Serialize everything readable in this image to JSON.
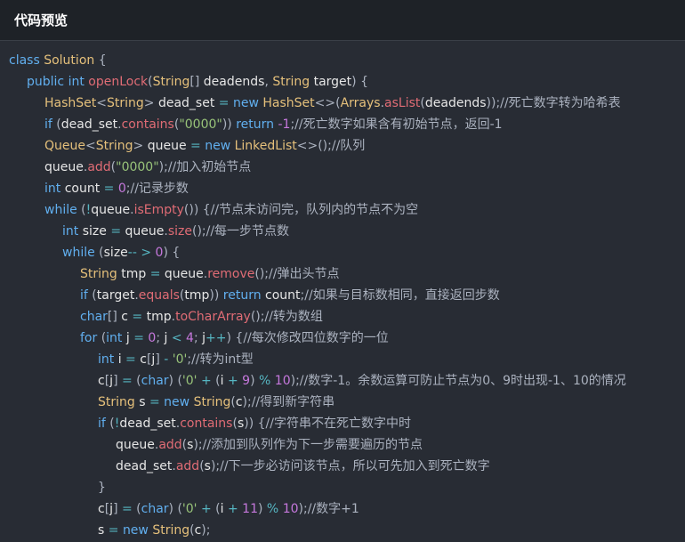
{
  "header": {
    "title": "代码预览"
  },
  "code_lines": [
    {
      "indent": 0,
      "tokens": [
        [
          "kw",
          "class"
        ],
        [
          "sp",
          " "
        ],
        [
          "type",
          "Solution"
        ],
        [
          "pun",
          " {"
        ]
      ]
    },
    {
      "indent": 1,
      "tokens": [
        [
          "kw",
          "public"
        ],
        [
          "sp",
          " "
        ],
        [
          "kw",
          "int"
        ],
        [
          "sp",
          " "
        ],
        [
          "fn",
          "openLock"
        ],
        [
          "pun",
          "("
        ],
        [
          "type",
          "String"
        ],
        [
          "pun",
          "[] "
        ],
        [
          "var",
          "deadends"
        ],
        [
          "pun",
          ", "
        ],
        [
          "type",
          "String"
        ],
        [
          "sp",
          " "
        ],
        [
          "var",
          "target"
        ],
        [
          "pun",
          ") {"
        ]
      ]
    },
    {
      "indent": 2,
      "tokens": [
        [
          "type",
          "HashSet"
        ],
        [
          "pun",
          "<"
        ],
        [
          "type",
          "String"
        ],
        [
          "pun",
          "> "
        ],
        [
          "var",
          "dead_set"
        ],
        [
          "op",
          " = "
        ],
        [
          "kw",
          "new"
        ],
        [
          "sp",
          " "
        ],
        [
          "type",
          "HashSet"
        ],
        [
          "pun",
          "<>("
        ],
        [
          "type",
          "Arrays"
        ],
        [
          "pun",
          "."
        ],
        [
          "fn",
          "asList"
        ],
        [
          "pun",
          "("
        ],
        [
          "var",
          "deadends"
        ],
        [
          "pun",
          "));"
        ],
        [
          "cm",
          "//死亡数字转为哈希表"
        ]
      ]
    },
    {
      "indent": 2,
      "tokens": [
        [
          "kw",
          "if"
        ],
        [
          "pun",
          " ("
        ],
        [
          "var",
          "dead_set"
        ],
        [
          "pun",
          "."
        ],
        [
          "fn",
          "contains"
        ],
        [
          "pun",
          "("
        ],
        [
          "str",
          "\"0000\""
        ],
        [
          "pun",
          ")) "
        ],
        [
          "kw",
          "return"
        ],
        [
          "sp",
          " "
        ],
        [
          "num",
          "-1"
        ],
        [
          "pun",
          ";"
        ],
        [
          "cm",
          "//死亡数字如果含有初始节点，返回-1"
        ]
      ]
    },
    {
      "indent": 2,
      "tokens": [
        [
          "type",
          "Queue"
        ],
        [
          "pun",
          "<"
        ],
        [
          "type",
          "String"
        ],
        [
          "pun",
          "> "
        ],
        [
          "var",
          "queue"
        ],
        [
          "op",
          " = "
        ],
        [
          "kw",
          "new"
        ],
        [
          "sp",
          " "
        ],
        [
          "type",
          "LinkedList"
        ],
        [
          "pun",
          "<>();"
        ],
        [
          "cm",
          "//队列"
        ]
      ]
    },
    {
      "indent": 2,
      "tokens": [
        [
          "var",
          "queue"
        ],
        [
          "pun",
          "."
        ],
        [
          "fn",
          "add"
        ],
        [
          "pun",
          "("
        ],
        [
          "str",
          "\"0000\""
        ],
        [
          "pun",
          ");"
        ],
        [
          "cm",
          "//加入初始节点"
        ]
      ]
    },
    {
      "indent": 2,
      "tokens": [
        [
          "kw",
          "int"
        ],
        [
          "sp",
          " "
        ],
        [
          "var",
          "count"
        ],
        [
          "op",
          " = "
        ],
        [
          "num",
          "0"
        ],
        [
          "pun",
          ";"
        ],
        [
          "cm",
          "//记录步数"
        ]
      ]
    },
    {
      "indent": 2,
      "tokens": [
        [
          "kw",
          "while"
        ],
        [
          "pun",
          " ("
        ],
        [
          "op",
          "!"
        ],
        [
          "var",
          "queue"
        ],
        [
          "pun",
          "."
        ],
        [
          "fn",
          "isEmpty"
        ],
        [
          "pun",
          "()) {"
        ],
        [
          "cm",
          "//节点未访问完，队列内的节点不为空"
        ]
      ]
    },
    {
      "indent": 3,
      "tokens": [
        [
          "kw",
          "int"
        ],
        [
          "sp",
          " "
        ],
        [
          "var",
          "size"
        ],
        [
          "op",
          " = "
        ],
        [
          "var",
          "queue"
        ],
        [
          "pun",
          "."
        ],
        [
          "fn",
          "size"
        ],
        [
          "pun",
          "();"
        ],
        [
          "cm",
          "//每一步节点数"
        ]
      ]
    },
    {
      "indent": 3,
      "tokens": [
        [
          "kw",
          "while"
        ],
        [
          "pun",
          " ("
        ],
        [
          "var",
          "size"
        ],
        [
          "op",
          "-- > "
        ],
        [
          "num",
          "0"
        ],
        [
          "pun",
          ") {"
        ]
      ]
    },
    {
      "indent": 4,
      "tokens": [
        [
          "type",
          "String"
        ],
        [
          "sp",
          " "
        ],
        [
          "var",
          "tmp"
        ],
        [
          "op",
          " = "
        ],
        [
          "var",
          "queue"
        ],
        [
          "pun",
          "."
        ],
        [
          "fn",
          "remove"
        ],
        [
          "pun",
          "();"
        ],
        [
          "cm",
          "//弹出头节点"
        ]
      ]
    },
    {
      "indent": 4,
      "tokens": [
        [
          "kw",
          "if"
        ],
        [
          "pun",
          " ("
        ],
        [
          "var",
          "target"
        ],
        [
          "pun",
          "."
        ],
        [
          "fn",
          "equals"
        ],
        [
          "pun",
          "("
        ],
        [
          "var",
          "tmp"
        ],
        [
          "pun",
          ")) "
        ],
        [
          "kw",
          "return"
        ],
        [
          "sp",
          " "
        ],
        [
          "var",
          "count"
        ],
        [
          "pun",
          ";"
        ],
        [
          "cm",
          "//如果与目标数相同，直接返回步数"
        ]
      ]
    },
    {
      "indent": 4,
      "tokens": [
        [
          "kw",
          "char"
        ],
        [
          "pun",
          "[] "
        ],
        [
          "var",
          "c"
        ],
        [
          "op",
          " = "
        ],
        [
          "var",
          "tmp"
        ],
        [
          "pun",
          "."
        ],
        [
          "fn",
          "toCharArray"
        ],
        [
          "pun",
          "();"
        ],
        [
          "cm",
          "//转为数组"
        ]
      ]
    },
    {
      "indent": 4,
      "tokens": [
        [
          "kw",
          "for"
        ],
        [
          "pun",
          " ("
        ],
        [
          "kw",
          "int"
        ],
        [
          "sp",
          " "
        ],
        [
          "var",
          "j"
        ],
        [
          "op",
          " = "
        ],
        [
          "num",
          "0"
        ],
        [
          "pun",
          "; "
        ],
        [
          "var",
          "j"
        ],
        [
          "op",
          " < "
        ],
        [
          "num",
          "4"
        ],
        [
          "pun",
          "; "
        ],
        [
          "var",
          "j"
        ],
        [
          "op",
          "++"
        ],
        [
          "pun",
          ") {"
        ],
        [
          "cm",
          "//每次修改四位数字的一位"
        ]
      ]
    },
    {
      "indent": 5,
      "tokens": [
        [
          "kw",
          "int"
        ],
        [
          "sp",
          " "
        ],
        [
          "var",
          "i"
        ],
        [
          "op",
          " = "
        ],
        [
          "var",
          "c"
        ],
        [
          "pun",
          "["
        ],
        [
          "var",
          "j"
        ],
        [
          "pun",
          "] "
        ],
        [
          "op",
          "- "
        ],
        [
          "str",
          "'0'"
        ],
        [
          "pun",
          ";"
        ],
        [
          "cm",
          "//转为int型"
        ]
      ]
    },
    {
      "indent": 5,
      "tokens": [
        [
          "var",
          "c"
        ],
        [
          "pun",
          "["
        ],
        [
          "var",
          "j"
        ],
        [
          "pun",
          "]"
        ],
        [
          "op",
          " = "
        ],
        [
          "pun",
          "("
        ],
        [
          "kw",
          "char"
        ],
        [
          "pun",
          ") ("
        ],
        [
          "str",
          "'0'"
        ],
        [
          "op",
          " + "
        ],
        [
          "pun",
          "("
        ],
        [
          "var",
          "i"
        ],
        [
          "op",
          " + "
        ],
        [
          "num",
          "9"
        ],
        [
          "pun",
          ") "
        ],
        [
          "op",
          "% "
        ],
        [
          "num",
          "10"
        ],
        [
          "pun",
          ");"
        ],
        [
          "cm",
          "//数字-1。余数运算可防止节点为0、9时出现-1、10的情况"
        ]
      ]
    },
    {
      "indent": 5,
      "tokens": [
        [
          "type",
          "String"
        ],
        [
          "sp",
          " "
        ],
        [
          "var",
          "s"
        ],
        [
          "op",
          " = "
        ],
        [
          "kw",
          "new"
        ],
        [
          "sp",
          " "
        ],
        [
          "type",
          "String"
        ],
        [
          "pun",
          "("
        ],
        [
          "var",
          "c"
        ],
        [
          "pun",
          ");"
        ],
        [
          "cm",
          "//得到新字符串"
        ]
      ]
    },
    {
      "indent": 5,
      "tokens": [
        [
          "kw",
          "if"
        ],
        [
          "pun",
          " ("
        ],
        [
          "op",
          "!"
        ],
        [
          "var",
          "dead_set"
        ],
        [
          "pun",
          "."
        ],
        [
          "fn",
          "contains"
        ],
        [
          "pun",
          "("
        ],
        [
          "var",
          "s"
        ],
        [
          "pun",
          ")) {"
        ],
        [
          "cm",
          "//字符串不在死亡数字中时"
        ]
      ]
    },
    {
      "indent": 6,
      "tokens": [
        [
          "var",
          "queue"
        ],
        [
          "pun",
          "."
        ],
        [
          "fn",
          "add"
        ],
        [
          "pun",
          "("
        ],
        [
          "var",
          "s"
        ],
        [
          "pun",
          ");"
        ],
        [
          "cm",
          "//添加到队列作为下一步需要遍历的节点"
        ]
      ]
    },
    {
      "indent": 6,
      "tokens": [
        [
          "var",
          "dead_set"
        ],
        [
          "pun",
          "."
        ],
        [
          "fn",
          "add"
        ],
        [
          "pun",
          "("
        ],
        [
          "var",
          "s"
        ],
        [
          "pun",
          ");"
        ],
        [
          "cm",
          "//下一步必访问该节点，所以可先加入到死亡数字"
        ]
      ]
    },
    {
      "indent": 5,
      "tokens": [
        [
          "pun",
          "}"
        ]
      ]
    },
    {
      "indent": 5,
      "tokens": [
        [
          "var",
          "c"
        ],
        [
          "pun",
          "["
        ],
        [
          "var",
          "j"
        ],
        [
          "pun",
          "]"
        ],
        [
          "op",
          " = "
        ],
        [
          "pun",
          "("
        ],
        [
          "kw",
          "char"
        ],
        [
          "pun",
          ") ("
        ],
        [
          "str",
          "'0'"
        ],
        [
          "op",
          " + "
        ],
        [
          "pun",
          "("
        ],
        [
          "var",
          "i"
        ],
        [
          "op",
          " + "
        ],
        [
          "num",
          "11"
        ],
        [
          "pun",
          ") "
        ],
        [
          "op",
          "% "
        ],
        [
          "num",
          "10"
        ],
        [
          "pun",
          ");"
        ],
        [
          "cm",
          "//数字+1"
        ]
      ]
    },
    {
      "indent": 5,
      "tokens": [
        [
          "var",
          "s"
        ],
        [
          "op",
          " = "
        ],
        [
          "kw",
          "new"
        ],
        [
          "sp",
          " "
        ],
        [
          "type",
          "String"
        ],
        [
          "pun",
          "("
        ],
        [
          "var",
          "c"
        ],
        [
          "pun",
          ");"
        ]
      ]
    }
  ]
}
